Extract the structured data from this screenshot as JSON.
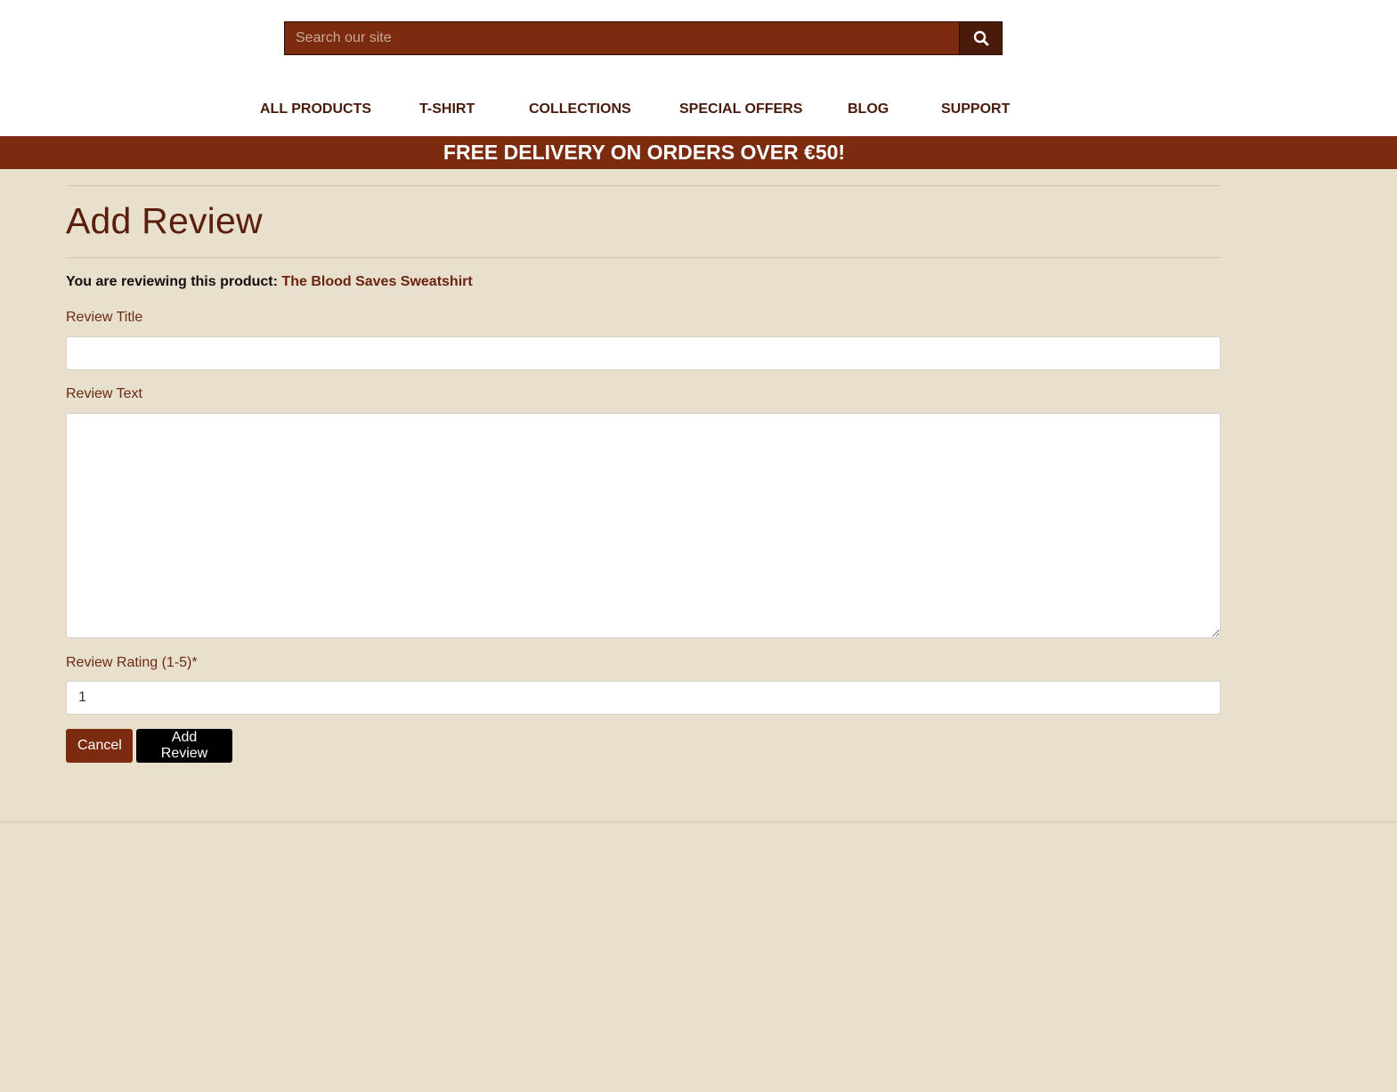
{
  "search": {
    "placeholder": "Search our site"
  },
  "nav": {
    "items": [
      {
        "label": "ALL PRODUCTS"
      },
      {
        "label": "T-SHIRT"
      },
      {
        "label": "COLLECTIONS"
      },
      {
        "label": "SPECIAL OFFERS"
      },
      {
        "label": "BLOG"
      },
      {
        "label": "SUPPORT"
      }
    ]
  },
  "banner": {
    "text": "FREE DELIVERY ON ORDERS OVER €50!"
  },
  "page": {
    "title": "Add Review",
    "reviewing_prefix": "You are reviewing this product:",
    "product_name": "The Blood Saves Sweatshirt"
  },
  "form": {
    "title_label": "Review Title",
    "title_value": "",
    "text_label": "Review Text",
    "text_value": "",
    "rating_label": "Review Rating (1-5)*",
    "rating_value": "1"
  },
  "buttons": {
    "cancel": "Cancel",
    "add_review": "Add Review"
  },
  "icons": {
    "search": "search-icon"
  },
  "colors": {
    "brand": "#7d2b0f",
    "background": "#e9dfcd",
    "heading": "#5a1f0c",
    "add_button": "#000000"
  }
}
